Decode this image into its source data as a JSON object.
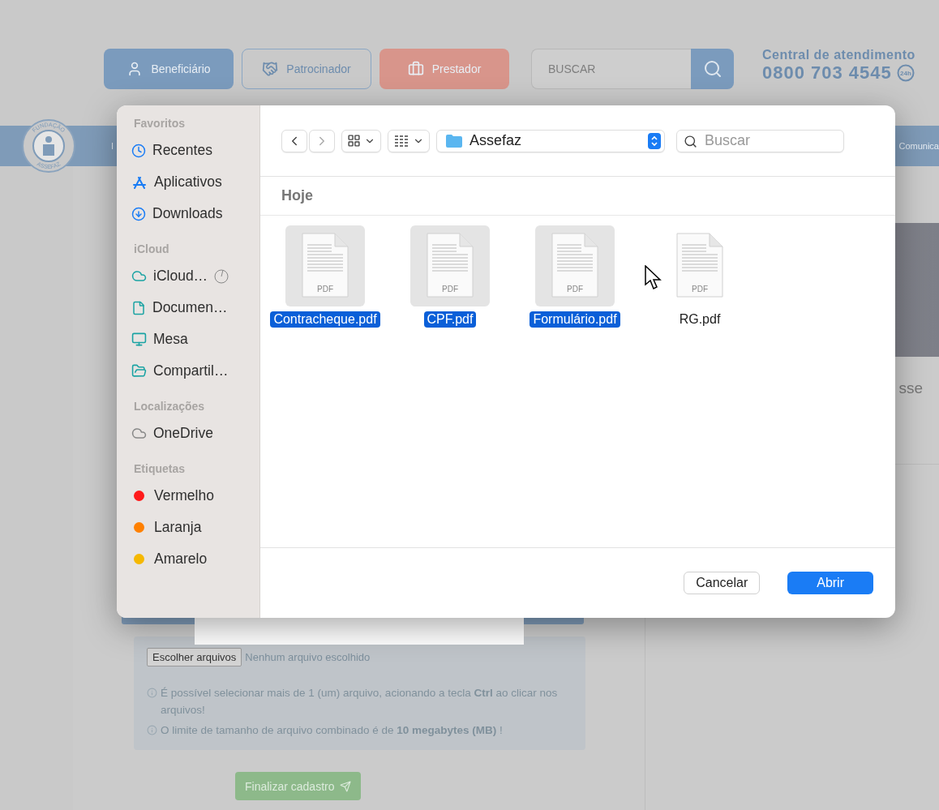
{
  "header": {
    "roles": [
      {
        "label": "Beneficiário",
        "kind": "primary"
      },
      {
        "label": "Patrocinador",
        "kind": "outline"
      },
      {
        "label": "Prestador",
        "kind": "accent"
      }
    ],
    "search": {
      "placeholder": "BUSCAR"
    },
    "contact": {
      "title": "Central de atendimento",
      "phone": "0800 703 4545",
      "badge": "24h"
    }
  },
  "logo": {
    "top": "FUNDAÇÃO",
    "bottom": "ASSEFAZ"
  },
  "nav": {
    "items": [
      "I",
      "Comunica"
    ]
  },
  "news": {
    "title": "sse"
  },
  "upload": {
    "button": "Escolher arquivos",
    "status": "Nenhum arquivo escolhido",
    "notes": [
      "É possível selecionar mais de 1 (um) arquivo, acionando a tecla **Ctrl** ao clicar nos arquivos!",
      "O limite de tamanho de arquivo combinado é de **10 megabytes (MB)** !"
    ],
    "submit": "Finalizar cadastro"
  },
  "dialog": {
    "sidebar": [
      {
        "heading": "Favoritos",
        "items": [
          {
            "label": "Recentes"
          },
          {
            "label": "Aplicativos"
          },
          {
            "label": "Downloads"
          }
        ]
      },
      {
        "heading": "iCloud",
        "items": [
          {
            "label": "iCloud…"
          },
          {
            "label": "Documen…"
          },
          {
            "label": "Mesa"
          },
          {
            "label": "Compartil…"
          }
        ]
      },
      {
        "heading": "Localizações",
        "items": [
          {
            "label": "OneDrive"
          }
        ]
      },
      {
        "heading": "Etiquetas",
        "items": [
          {
            "label": "Vermelho",
            "color": "#ff1a1a"
          },
          {
            "label": "Laranja",
            "color": "#ff8000"
          },
          {
            "label": "Amarelo",
            "color": "#f5b800"
          }
        ]
      }
    ],
    "folder": "Assefaz",
    "search": {
      "placeholder": "Buscar"
    },
    "section": "Hoje",
    "files": [
      {
        "name": "Contracheque.pdf",
        "type": "PDF",
        "selected": true
      },
      {
        "name": "CPF.pdf",
        "type": "PDF",
        "selected": true
      },
      {
        "name": "Formulário.pdf",
        "type": "PDF",
        "selected": true
      },
      {
        "name": "RG.pdf",
        "type": "PDF",
        "selected": false
      }
    ],
    "buttons": [
      {
        "label": "Cancelar",
        "kind": "secondary"
      },
      {
        "label": "Abrir",
        "kind": "default"
      }
    ]
  }
}
